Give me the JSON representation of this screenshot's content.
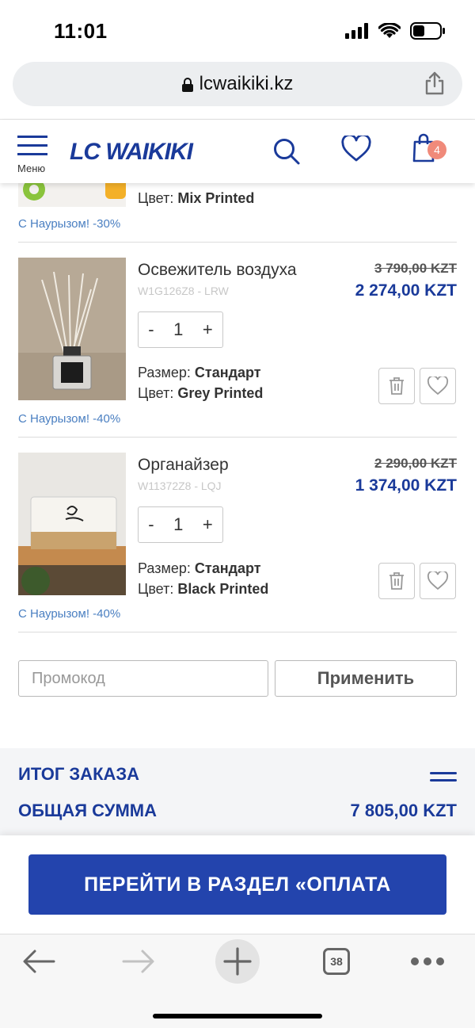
{
  "status": {
    "time": "11:01"
  },
  "browser": {
    "url": "lcwaikiki.kz",
    "tabs_count": "38"
  },
  "header": {
    "menu_label": "Меню",
    "logo": "LC WAIKIKI",
    "cart_count": "4"
  },
  "cart_items": [
    {
      "name": "",
      "color_label": "Цвет:",
      "color": "Mix Printed",
      "promo": "С Наурызом! -30%"
    },
    {
      "name": "Освежитель воздуха",
      "code": "W1G126Z8 - LRW",
      "quantity": "1",
      "size_label": "Размер:",
      "size": "Стандарт",
      "color_label": "Цвет:",
      "color": "Grey Printed",
      "old_price": "3 790,00 KZT",
      "new_price": "2 274,00 KZT",
      "promo": "С Наурызом! -40%"
    },
    {
      "name": "Органайзер",
      "code": "W11372Z8 - LQJ",
      "quantity": "1",
      "size_label": "Размер:",
      "size": "Стандарт",
      "color_label": "Цвет:",
      "color": "Black Printed",
      "old_price": "2 290,00 KZT",
      "new_price": "1 374,00 KZT",
      "promo": "С Наурызом! -40%"
    }
  ],
  "qty_controls": {
    "minus": "-",
    "plus": "+"
  },
  "promo_code": {
    "placeholder": "Промокод",
    "apply_label": "Применить"
  },
  "summary": {
    "title": "ИТОГ ЗАКАЗА",
    "total_label": "ОБЩАЯ СУММА",
    "total_value": "7 805,00 KZT"
  },
  "checkout": {
    "label": "ПЕРЕЙТИ В РАЗДЕЛ «ОПЛАТА"
  },
  "colors": {
    "brand_blue": "#1a3a9a",
    "button_blue": "#2344ad",
    "promo_blue": "#4a7fc1",
    "badge": "#f08a7a"
  }
}
